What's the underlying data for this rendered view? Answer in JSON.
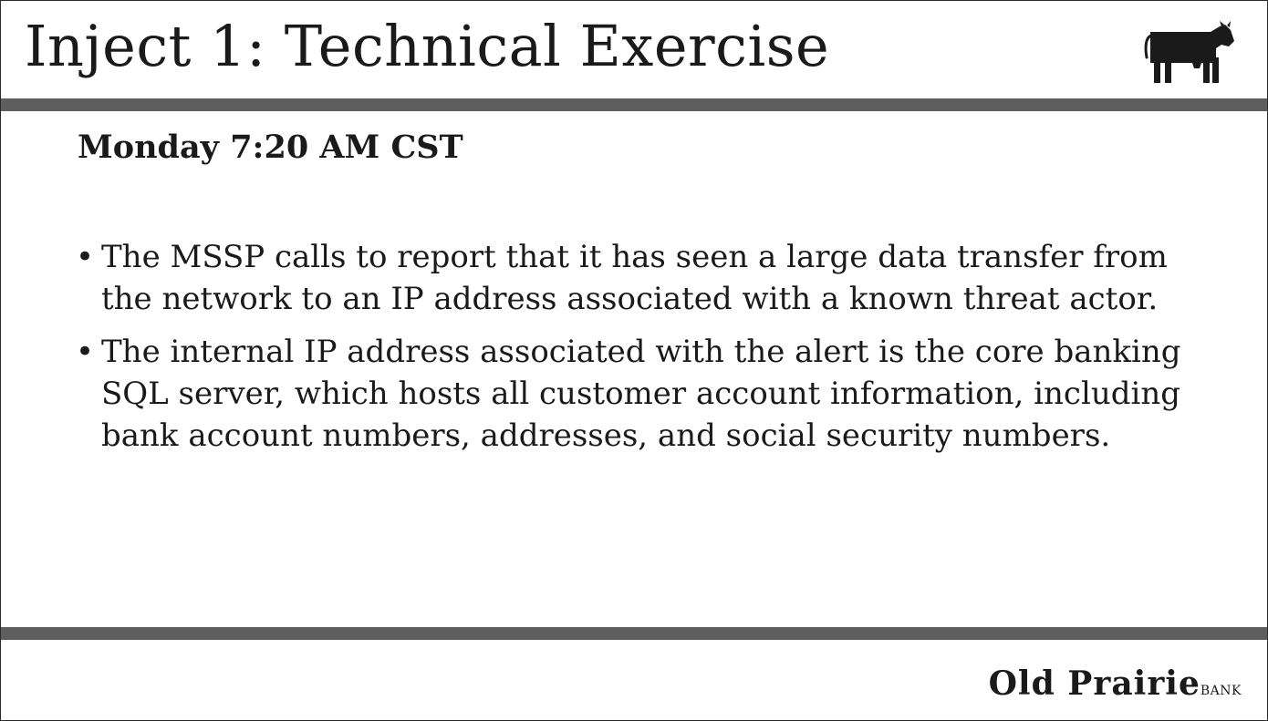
{
  "slide": {
    "title": "Inject 1: Technical Exercise",
    "subtitle": "Monday 7:20 AM CST",
    "bullet_symbol": "•",
    "bullets": [
      "The MSSP calls to report that it has seen a large data transfer from the network to an IP address associated with a known threat actor.",
      "The internal IP address associated with the alert is the core banking SQL server, which hosts all customer account information, including bank account numbers, addresses, and social security numbers."
    ]
  },
  "branding": {
    "name": "Old Prairie",
    "suffix": "BANK",
    "logo_icon": "cow-icon"
  },
  "colors": {
    "rule": "#5e5e5e",
    "text": "#1a1a1a",
    "background": "#ffffff"
  }
}
